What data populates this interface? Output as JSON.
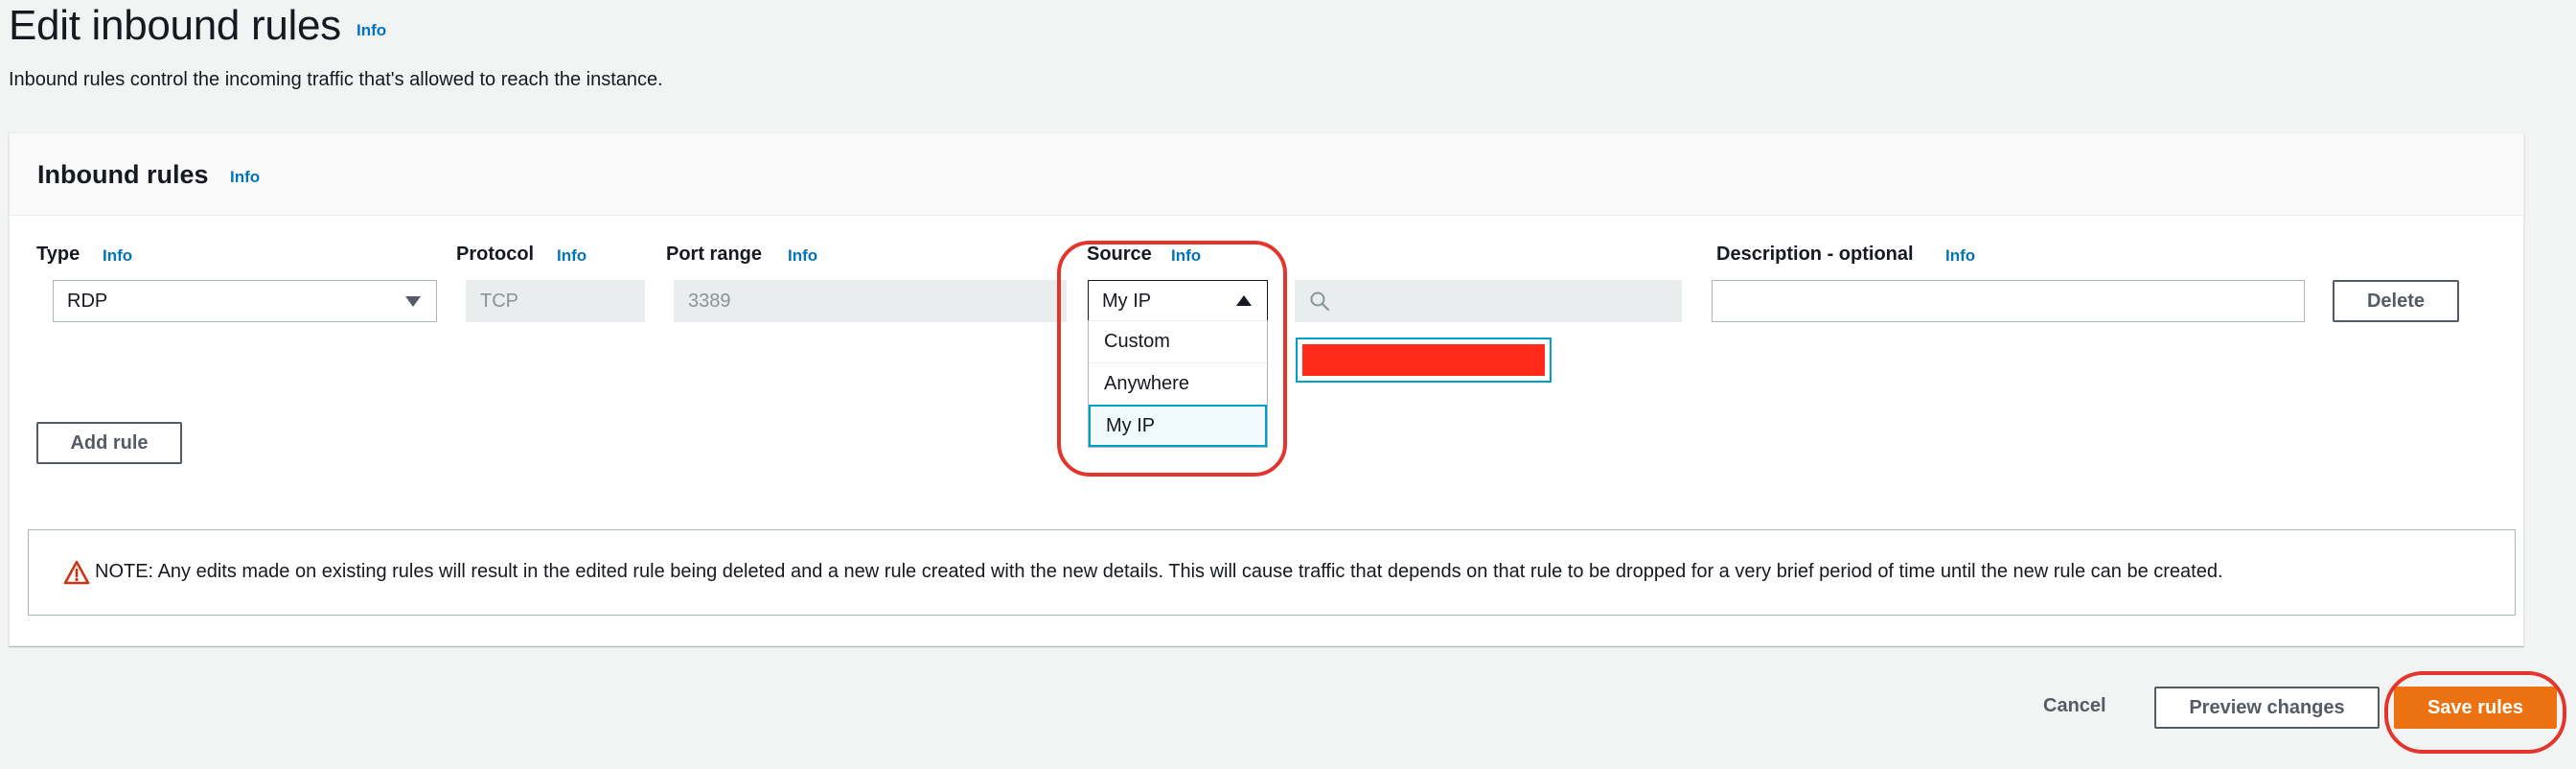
{
  "header": {
    "title": "Edit inbound rules",
    "title_info": "Info",
    "description": "Inbound rules control the incoming traffic that's allowed to reach the instance."
  },
  "panel": {
    "title": "Inbound rules",
    "title_info": "Info"
  },
  "columns": {
    "type": {
      "label": "Type",
      "info": "Info"
    },
    "protocol": {
      "label": "Protocol",
      "info": "Info"
    },
    "port_range": {
      "label": "Port range",
      "info": "Info"
    },
    "source": {
      "label": "Source",
      "info": "Info"
    },
    "description": {
      "label": "Description - optional",
      "info": "Info"
    }
  },
  "rule": {
    "type_value": "RDP",
    "protocol_value": "TCP",
    "port_value": "3389",
    "source_value": "My IP",
    "source_search_value": "",
    "source_cidr_redacted": true,
    "description_value": "",
    "delete_label": "Delete"
  },
  "source_dropdown": {
    "options": [
      "Custom",
      "Anywhere",
      "My IP"
    ],
    "selected": "My IP"
  },
  "add_rule_label": "Add rule",
  "note": {
    "text": "NOTE: Any edits made on existing rules will result in the edited rule being deleted and a new rule created with the new details. This will cause traffic that depends on that rule to be dropped for a very brief period of time until the new rule can be created."
  },
  "footer": {
    "cancel_label": "Cancel",
    "preview_label": "Preview changes",
    "save_label": "Save rules"
  },
  "colors": {
    "accent": "#0073bb",
    "primary_button": "#ec7211",
    "highlight": "#e3352c",
    "redaction": "#ff2a1a"
  }
}
